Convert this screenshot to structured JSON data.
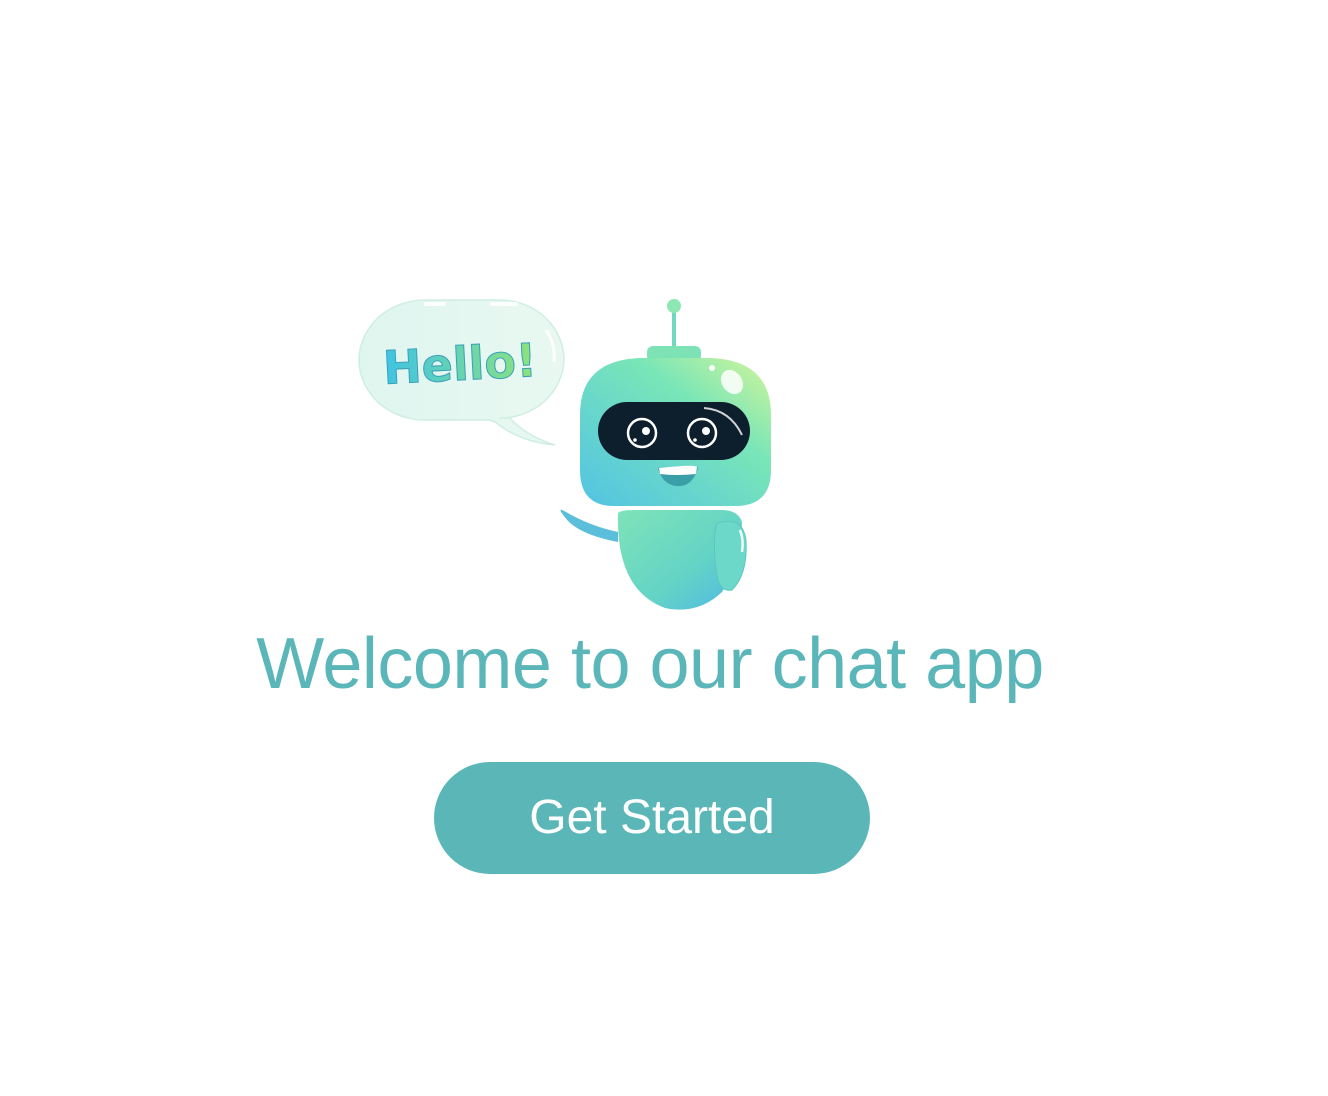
{
  "hero": {
    "bubble_text": "Hello!",
    "illustration_icon": "robot-mascot-icon",
    "title": "Welcome to our chat app"
  },
  "cta": {
    "label": "Get Started"
  },
  "colors": {
    "accent": "#5bb6b8",
    "title": "#5ab6b8",
    "background": "#ffffff"
  }
}
